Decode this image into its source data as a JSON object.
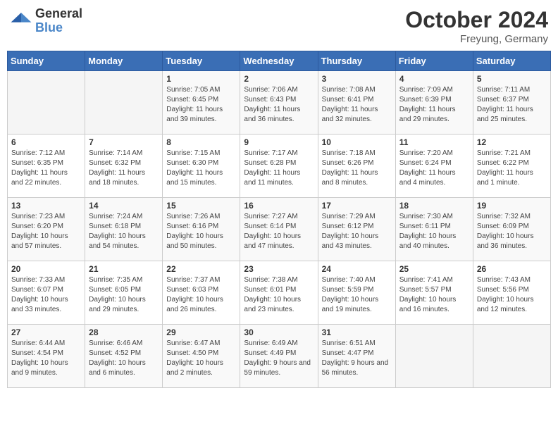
{
  "header": {
    "logo": {
      "general": "General",
      "blue": "Blue"
    },
    "title": "October 2024",
    "location": "Freyung, Germany"
  },
  "calendar": {
    "columns": [
      "Sunday",
      "Monday",
      "Tuesday",
      "Wednesday",
      "Thursday",
      "Friday",
      "Saturday"
    ],
    "weeks": [
      [
        {
          "day": "",
          "info": ""
        },
        {
          "day": "",
          "info": ""
        },
        {
          "day": "1",
          "info": "Sunrise: 7:05 AM\nSunset: 6:45 PM\nDaylight: 11 hours and 39 minutes."
        },
        {
          "day": "2",
          "info": "Sunrise: 7:06 AM\nSunset: 6:43 PM\nDaylight: 11 hours and 36 minutes."
        },
        {
          "day": "3",
          "info": "Sunrise: 7:08 AM\nSunset: 6:41 PM\nDaylight: 11 hours and 32 minutes."
        },
        {
          "day": "4",
          "info": "Sunrise: 7:09 AM\nSunset: 6:39 PM\nDaylight: 11 hours and 29 minutes."
        },
        {
          "day": "5",
          "info": "Sunrise: 7:11 AM\nSunset: 6:37 PM\nDaylight: 11 hours and 25 minutes."
        }
      ],
      [
        {
          "day": "6",
          "info": "Sunrise: 7:12 AM\nSunset: 6:35 PM\nDaylight: 11 hours and 22 minutes."
        },
        {
          "day": "7",
          "info": "Sunrise: 7:14 AM\nSunset: 6:32 PM\nDaylight: 11 hours and 18 minutes."
        },
        {
          "day": "8",
          "info": "Sunrise: 7:15 AM\nSunset: 6:30 PM\nDaylight: 11 hours and 15 minutes."
        },
        {
          "day": "9",
          "info": "Sunrise: 7:17 AM\nSunset: 6:28 PM\nDaylight: 11 hours and 11 minutes."
        },
        {
          "day": "10",
          "info": "Sunrise: 7:18 AM\nSunset: 6:26 PM\nDaylight: 11 hours and 8 minutes."
        },
        {
          "day": "11",
          "info": "Sunrise: 7:20 AM\nSunset: 6:24 PM\nDaylight: 11 hours and 4 minutes."
        },
        {
          "day": "12",
          "info": "Sunrise: 7:21 AM\nSunset: 6:22 PM\nDaylight: 11 hours and 1 minute."
        }
      ],
      [
        {
          "day": "13",
          "info": "Sunrise: 7:23 AM\nSunset: 6:20 PM\nDaylight: 10 hours and 57 minutes."
        },
        {
          "day": "14",
          "info": "Sunrise: 7:24 AM\nSunset: 6:18 PM\nDaylight: 10 hours and 54 minutes."
        },
        {
          "day": "15",
          "info": "Sunrise: 7:26 AM\nSunset: 6:16 PM\nDaylight: 10 hours and 50 minutes."
        },
        {
          "day": "16",
          "info": "Sunrise: 7:27 AM\nSunset: 6:14 PM\nDaylight: 10 hours and 47 minutes."
        },
        {
          "day": "17",
          "info": "Sunrise: 7:29 AM\nSunset: 6:12 PM\nDaylight: 10 hours and 43 minutes."
        },
        {
          "day": "18",
          "info": "Sunrise: 7:30 AM\nSunset: 6:11 PM\nDaylight: 10 hours and 40 minutes."
        },
        {
          "day": "19",
          "info": "Sunrise: 7:32 AM\nSunset: 6:09 PM\nDaylight: 10 hours and 36 minutes."
        }
      ],
      [
        {
          "day": "20",
          "info": "Sunrise: 7:33 AM\nSunset: 6:07 PM\nDaylight: 10 hours and 33 minutes."
        },
        {
          "day": "21",
          "info": "Sunrise: 7:35 AM\nSunset: 6:05 PM\nDaylight: 10 hours and 29 minutes."
        },
        {
          "day": "22",
          "info": "Sunrise: 7:37 AM\nSunset: 6:03 PM\nDaylight: 10 hours and 26 minutes."
        },
        {
          "day": "23",
          "info": "Sunrise: 7:38 AM\nSunset: 6:01 PM\nDaylight: 10 hours and 23 minutes."
        },
        {
          "day": "24",
          "info": "Sunrise: 7:40 AM\nSunset: 5:59 PM\nDaylight: 10 hours and 19 minutes."
        },
        {
          "day": "25",
          "info": "Sunrise: 7:41 AM\nSunset: 5:57 PM\nDaylight: 10 hours and 16 minutes."
        },
        {
          "day": "26",
          "info": "Sunrise: 7:43 AM\nSunset: 5:56 PM\nDaylight: 10 hours and 12 minutes."
        }
      ],
      [
        {
          "day": "27",
          "info": "Sunrise: 6:44 AM\nSunset: 4:54 PM\nDaylight: 10 hours and 9 minutes."
        },
        {
          "day": "28",
          "info": "Sunrise: 6:46 AM\nSunset: 4:52 PM\nDaylight: 10 hours and 6 minutes."
        },
        {
          "day": "29",
          "info": "Sunrise: 6:47 AM\nSunset: 4:50 PM\nDaylight: 10 hours and 2 minutes."
        },
        {
          "day": "30",
          "info": "Sunrise: 6:49 AM\nSunset: 4:49 PM\nDaylight: 9 hours and 59 minutes."
        },
        {
          "day": "31",
          "info": "Sunrise: 6:51 AM\nSunset: 4:47 PM\nDaylight: 9 hours and 56 minutes."
        },
        {
          "day": "",
          "info": ""
        },
        {
          "day": "",
          "info": ""
        }
      ]
    ]
  }
}
